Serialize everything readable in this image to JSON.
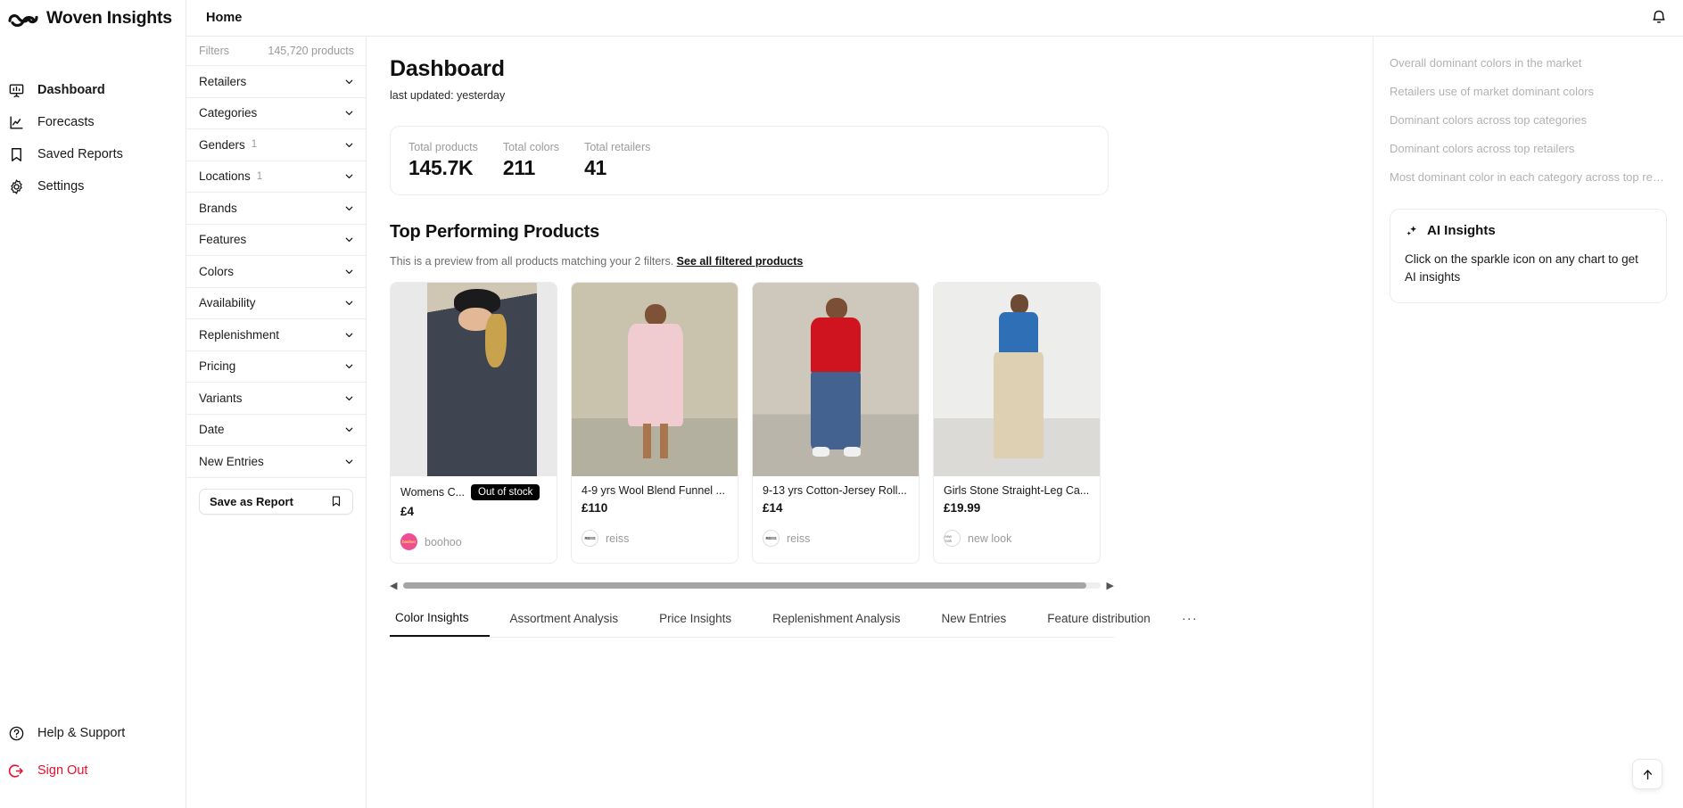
{
  "brand": {
    "name": "Woven Insights",
    "logo_icon": "infinity-loop-logo"
  },
  "nav": {
    "items": [
      {
        "label": "Dashboard",
        "icon": "presentation-chart-icon",
        "active": true
      },
      {
        "label": "Forecasts",
        "icon": "line-chart-icon",
        "active": false
      },
      {
        "label": "Saved Reports",
        "icon": "bookmark-icon",
        "active": false
      },
      {
        "label": "Settings",
        "icon": "gear-icon",
        "active": false
      }
    ],
    "bottom": [
      {
        "label": "Help & Support",
        "icon": "question-circle-icon"
      },
      {
        "label": "Sign Out",
        "icon": "sign-out-icon",
        "color": "#e8112d"
      }
    ]
  },
  "topbar": {
    "title": "Home",
    "bell_icon": "notification-bell-icon"
  },
  "filters": {
    "heading": "Filters",
    "product_count": "145,720 products",
    "rows": [
      {
        "label": "Retailers",
        "badge": ""
      },
      {
        "label": "Categories",
        "badge": ""
      },
      {
        "label": "Genders",
        "badge": "1"
      },
      {
        "label": "Locations",
        "badge": "1"
      },
      {
        "label": "Brands",
        "badge": ""
      },
      {
        "label": "Features",
        "badge": ""
      },
      {
        "label": "Colors",
        "badge": ""
      },
      {
        "label": "Availability",
        "badge": ""
      },
      {
        "label": "Replenishment",
        "badge": ""
      },
      {
        "label": "Pricing",
        "badge": ""
      },
      {
        "label": "Variants",
        "badge": ""
      },
      {
        "label": "Date",
        "badge": ""
      },
      {
        "label": "New Entries",
        "badge": ""
      }
    ],
    "save_button": "Save as Report",
    "save_icon": "bookmark-icon"
  },
  "main": {
    "title": "Dashboard",
    "last_updated": "last updated: yesterday",
    "stats": [
      {
        "label": "Total products",
        "value": "145.7K"
      },
      {
        "label": "Total colors",
        "value": "211"
      },
      {
        "label": "Total retailers",
        "value": "41"
      }
    ],
    "section_title": "Top Performing Products",
    "preview_text": "This is a preview from all products matching your 2 filters.",
    "preview_link": "See all filtered products",
    "products": [
      {
        "title": "Womens C...",
        "badge": "Out of stock",
        "price": "£4",
        "brand": "boohoo",
        "brand_logo_text": "boohoo",
        "brand_logo_bg": "#ef4d94",
        "brand_logo_fg": "#ffe24a",
        "image_class": "img-boohoo"
      },
      {
        "title": "4-9 yrs Wool Blend Funnel ...",
        "badge": "",
        "price": "£110",
        "brand": "reiss",
        "brand_logo_text": "REISS",
        "brand_logo_bg": "#ffffff",
        "brand_logo_fg": "#333333",
        "image_class": "img-reiss1"
      },
      {
        "title": "9-13 yrs Cotton-Jersey Roll...",
        "badge": "",
        "price": "£14",
        "brand": "reiss",
        "brand_logo_text": "REISS",
        "brand_logo_bg": "#ffffff",
        "brand_logo_fg": "#333333",
        "image_class": "img-reiss2"
      },
      {
        "title": "Girls Stone Straight-Leg Ca...",
        "badge": "",
        "price": "£19.99",
        "brand": "new look",
        "brand_logo_text": "new look",
        "brand_logo_bg": "#ffffff",
        "brand_logo_fg": "#999999",
        "image_class": "img-newlook"
      }
    ],
    "carousel": {
      "left_arrow": "◀",
      "right_arrow": "▶",
      "thumb_percent": 98
    },
    "tabs": [
      {
        "label": "Color Insights",
        "active": true
      },
      {
        "label": "Assortment Analysis",
        "active": false
      },
      {
        "label": "Price Insights",
        "active": false
      },
      {
        "label": "Replenishment Analysis",
        "active": false
      },
      {
        "label": "New Entries",
        "active": false
      },
      {
        "label": "Feature distribution",
        "active": false
      }
    ],
    "tabs_overflow": "···"
  },
  "toc": {
    "items": [
      "Overall dominant colors in the market",
      "Retailers use of market dominant colors",
      "Dominant colors across top categories",
      "Dominant colors across top retailers",
      "Most dominant color in each category across top retail..."
    ],
    "ai_card": {
      "icon": "sparkle-icon",
      "title": "AI Insights",
      "body": "Click on the sparkle icon on any chart to get AI insights"
    }
  },
  "scroll_top_button": {
    "icon": "arrow-up-icon"
  }
}
